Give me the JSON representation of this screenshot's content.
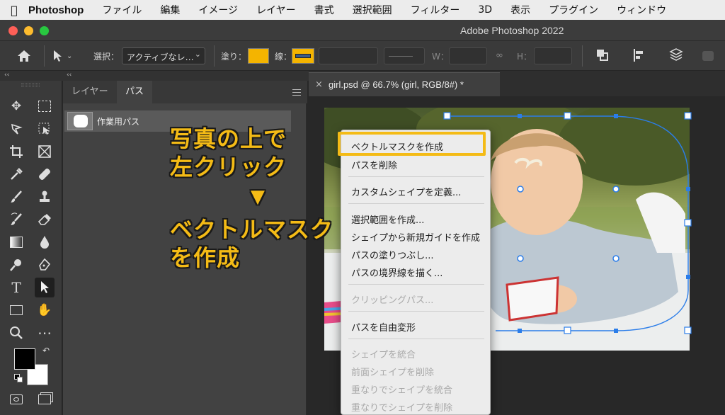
{
  "menubar": {
    "app": "Photoshop",
    "items": [
      "ファイル",
      "編集",
      "イメージ",
      "レイヤー",
      "書式",
      "選択範囲",
      "フィルター",
      "3D",
      "表示",
      "プラグイン",
      "ウィンドウ"
    ]
  },
  "window": {
    "title": "Adobe Photoshop 2022"
  },
  "options": {
    "select_label": "選択：",
    "select_value": "アクティブなレ…",
    "fill_label": "塗り：",
    "stroke_label": "線：",
    "w_label": "W：",
    "h_label": "H：",
    "fill_color": "#f4b400"
  },
  "panel": {
    "tabs": [
      "レイヤー",
      "パス"
    ],
    "active_tab": "パス",
    "path_name": "作業用パス"
  },
  "document": {
    "tab_title": "girl.psd @ 66.7% (girl, RGB/8#) *"
  },
  "annotation": {
    "line1": "写真の上で",
    "line2": "左クリック",
    "arrow": "▼",
    "line3": "ベクトルマスク",
    "line4": "を作成"
  },
  "context_menu": {
    "items": [
      {
        "label": "ベクトルマスクを作成",
        "disabled": false
      },
      {
        "label": "パスを削除",
        "disabled": false
      },
      {
        "label": "カスタムシェイプを定義...",
        "disabled": false
      },
      {
        "label": "選択範囲を作成...",
        "disabled": false
      },
      {
        "label": "シェイプから新規ガイドを作成",
        "disabled": false
      },
      {
        "label": "パスの塗りつぶし...",
        "disabled": false
      },
      {
        "label": "パスの境界線を描く...",
        "disabled": false
      },
      {
        "label": "クリッピングパス...",
        "disabled": true
      },
      {
        "label": "パスを自由変形",
        "disabled": false
      },
      {
        "label": "シェイプを統合",
        "disabled": true
      },
      {
        "label": "前面シェイプを削除",
        "disabled": true
      },
      {
        "label": "重なりでシェイプを統合",
        "disabled": true
      },
      {
        "label": "重なりでシェイプを削除",
        "disabled": true
      }
    ]
  },
  "colors": {
    "accent": "#f4bb16",
    "path_blue": "#2b7de9"
  }
}
